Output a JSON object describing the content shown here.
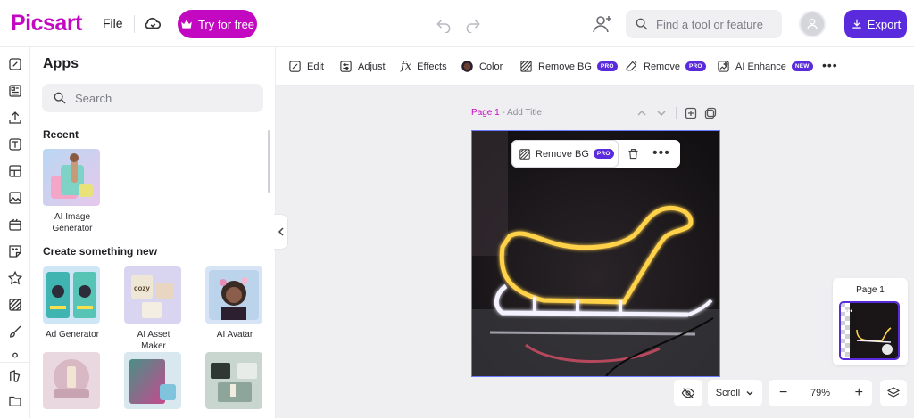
{
  "header": {
    "logo": "Picsart",
    "file_label": "File",
    "try_label": "Try for free",
    "search_placeholder": "Find a tool or feature",
    "export_label": "Export"
  },
  "panel": {
    "title": "Apps",
    "search_placeholder": "Search",
    "recent_heading": "Recent",
    "recent": [
      {
        "label": "AI Image Generator"
      }
    ],
    "create_heading": "Create something new",
    "create": [
      {
        "label": "Ad Generator"
      },
      {
        "label": "AI Asset Maker"
      },
      {
        "label": "AI Avatar"
      }
    ]
  },
  "toolbar": {
    "edit": "Edit",
    "adjust": "Adjust",
    "effects": "Effects",
    "color": "Color",
    "remove_bg": "Remove BG",
    "remove_bg_badge": "PRO",
    "remove": "Remove",
    "remove_badge": "PRO",
    "ai_enhance": "AI Enhance",
    "ai_enhance_badge": "NEW",
    "more": "•••"
  },
  "canvas": {
    "page_num": "Page 1",
    "page_title_placeholder": " - Add Title",
    "float_remove_bg": "Remove BG",
    "float_badge": "PRO",
    "float_more": "•••"
  },
  "pages_panel": {
    "title": "Page 1"
  },
  "bottom": {
    "scroll_label": "Scroll",
    "zoom": "79%"
  },
  "colors": {
    "brand": "#c209c1",
    "accent": "#5a2bdc",
    "canvas_bg": "#efeff2"
  }
}
